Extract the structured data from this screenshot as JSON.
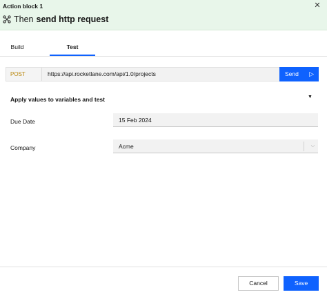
{
  "header": {
    "block_title": "Action block 1",
    "step_prefix": "Then",
    "step_name": "send http request",
    "step_icon": "action-icon",
    "close_icon": "close-icon"
  },
  "tabs": [
    {
      "label": "Build",
      "active": false
    },
    {
      "label": "Test",
      "active": true
    }
  ],
  "request": {
    "method": "POST",
    "url": "https://api.rocketlane.com/api/1.0/projects",
    "send_label": "Send",
    "send_icon": "send-icon"
  },
  "section": {
    "title": "Apply values to variables and test",
    "toggle_icon": "caret-down-icon"
  },
  "fields": [
    {
      "label": "Due Date",
      "value": "15 Feb 2024"
    },
    {
      "label": "Company",
      "value": "Acme",
      "icon": "chevron-down-icon"
    }
  ],
  "footer": {
    "cancel_label": "Cancel",
    "save_label": "Save"
  },
  "colors": {
    "header_bg": "#e8f6ea",
    "accent": "#0f62fe",
    "method_color": "#b8860b"
  }
}
